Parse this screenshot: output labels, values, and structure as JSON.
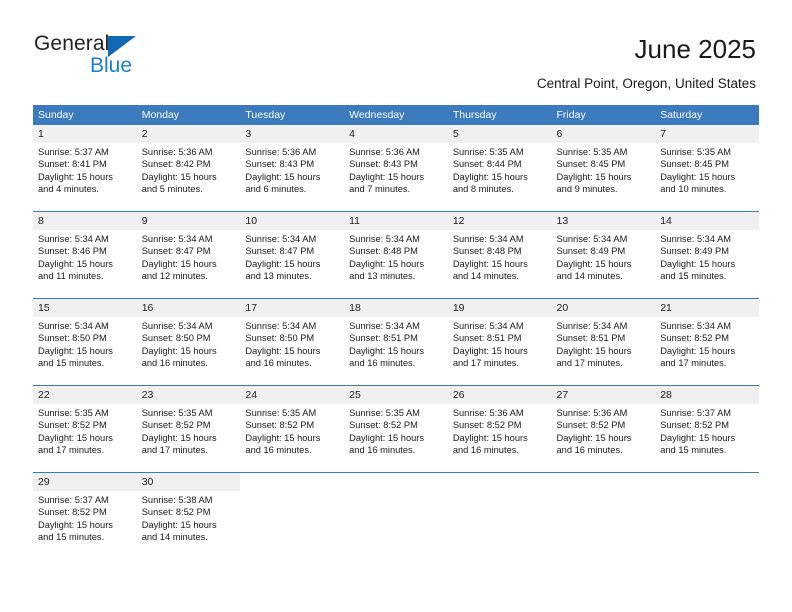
{
  "brand": {
    "name_part1": "General",
    "name_part2": "Blue",
    "triangle_color": "#1268b3",
    "blue_text_color": "#1b81d4"
  },
  "header": {
    "title": "June 2025",
    "subtitle": "Central Point, Oregon, United States",
    "header_bg_color": "#3a7abd",
    "daynum_bg_color": "#f0f0f0"
  },
  "columns": [
    "Sunday",
    "Monday",
    "Tuesday",
    "Wednesday",
    "Thursday",
    "Friday",
    "Saturday"
  ],
  "labels": {
    "sunrise_prefix": "Sunrise:",
    "sunset_prefix": "Sunset:",
    "daylight_prefix": "Daylight:"
  },
  "weeks": [
    [
      {
        "day": "1",
        "sunrise": "Sunrise: 5:37 AM",
        "sunset": "Sunset: 8:41 PM",
        "daylight_line1": "Daylight: 15 hours",
        "daylight_line2": "and 4 minutes."
      },
      {
        "day": "2",
        "sunrise": "Sunrise: 5:36 AM",
        "sunset": "Sunset: 8:42 PM",
        "daylight_line1": "Daylight: 15 hours",
        "daylight_line2": "and 5 minutes."
      },
      {
        "day": "3",
        "sunrise": "Sunrise: 5:36 AM",
        "sunset": "Sunset: 8:43 PM",
        "daylight_line1": "Daylight: 15 hours",
        "daylight_line2": "and 6 minutes."
      },
      {
        "day": "4",
        "sunrise": "Sunrise: 5:36 AM",
        "sunset": "Sunset: 8:43 PM",
        "daylight_line1": "Daylight: 15 hours",
        "daylight_line2": "and 7 minutes."
      },
      {
        "day": "5",
        "sunrise": "Sunrise: 5:35 AM",
        "sunset": "Sunset: 8:44 PM",
        "daylight_line1": "Daylight: 15 hours",
        "daylight_line2": "and 8 minutes."
      },
      {
        "day": "6",
        "sunrise": "Sunrise: 5:35 AM",
        "sunset": "Sunset: 8:45 PM",
        "daylight_line1": "Daylight: 15 hours",
        "daylight_line2": "and 9 minutes."
      },
      {
        "day": "7",
        "sunrise": "Sunrise: 5:35 AM",
        "sunset": "Sunset: 8:45 PM",
        "daylight_line1": "Daylight: 15 hours",
        "daylight_line2": "and 10 minutes."
      }
    ],
    [
      {
        "day": "8",
        "sunrise": "Sunrise: 5:34 AM",
        "sunset": "Sunset: 8:46 PM",
        "daylight_line1": "Daylight: 15 hours",
        "daylight_line2": "and 11 minutes."
      },
      {
        "day": "9",
        "sunrise": "Sunrise: 5:34 AM",
        "sunset": "Sunset: 8:47 PM",
        "daylight_line1": "Daylight: 15 hours",
        "daylight_line2": "and 12 minutes."
      },
      {
        "day": "10",
        "sunrise": "Sunrise: 5:34 AM",
        "sunset": "Sunset: 8:47 PM",
        "daylight_line1": "Daylight: 15 hours",
        "daylight_line2": "and 13 minutes."
      },
      {
        "day": "11",
        "sunrise": "Sunrise: 5:34 AM",
        "sunset": "Sunset: 8:48 PM",
        "daylight_line1": "Daylight: 15 hours",
        "daylight_line2": "and 13 minutes."
      },
      {
        "day": "12",
        "sunrise": "Sunrise: 5:34 AM",
        "sunset": "Sunset: 8:48 PM",
        "daylight_line1": "Daylight: 15 hours",
        "daylight_line2": "and 14 minutes."
      },
      {
        "day": "13",
        "sunrise": "Sunrise: 5:34 AM",
        "sunset": "Sunset: 8:49 PM",
        "daylight_line1": "Daylight: 15 hours",
        "daylight_line2": "and 14 minutes."
      },
      {
        "day": "14",
        "sunrise": "Sunrise: 5:34 AM",
        "sunset": "Sunset: 8:49 PM",
        "daylight_line1": "Daylight: 15 hours",
        "daylight_line2": "and 15 minutes."
      }
    ],
    [
      {
        "day": "15",
        "sunrise": "Sunrise: 5:34 AM",
        "sunset": "Sunset: 8:50 PM",
        "daylight_line1": "Daylight: 15 hours",
        "daylight_line2": "and 15 minutes."
      },
      {
        "day": "16",
        "sunrise": "Sunrise: 5:34 AM",
        "sunset": "Sunset: 8:50 PM",
        "daylight_line1": "Daylight: 15 hours",
        "daylight_line2": "and 16 minutes."
      },
      {
        "day": "17",
        "sunrise": "Sunrise: 5:34 AM",
        "sunset": "Sunset: 8:50 PM",
        "daylight_line1": "Daylight: 15 hours",
        "daylight_line2": "and 16 minutes."
      },
      {
        "day": "18",
        "sunrise": "Sunrise: 5:34 AM",
        "sunset": "Sunset: 8:51 PM",
        "daylight_line1": "Daylight: 15 hours",
        "daylight_line2": "and 16 minutes."
      },
      {
        "day": "19",
        "sunrise": "Sunrise: 5:34 AM",
        "sunset": "Sunset: 8:51 PM",
        "daylight_line1": "Daylight: 15 hours",
        "daylight_line2": "and 17 minutes."
      },
      {
        "day": "20",
        "sunrise": "Sunrise: 5:34 AM",
        "sunset": "Sunset: 8:51 PM",
        "daylight_line1": "Daylight: 15 hours",
        "daylight_line2": "and 17 minutes."
      },
      {
        "day": "21",
        "sunrise": "Sunrise: 5:34 AM",
        "sunset": "Sunset: 8:52 PM",
        "daylight_line1": "Daylight: 15 hours",
        "daylight_line2": "and 17 minutes."
      }
    ],
    [
      {
        "day": "22",
        "sunrise": "Sunrise: 5:35 AM",
        "sunset": "Sunset: 8:52 PM",
        "daylight_line1": "Daylight: 15 hours",
        "daylight_line2": "and 17 minutes."
      },
      {
        "day": "23",
        "sunrise": "Sunrise: 5:35 AM",
        "sunset": "Sunset: 8:52 PM",
        "daylight_line1": "Daylight: 15 hours",
        "daylight_line2": "and 17 minutes."
      },
      {
        "day": "24",
        "sunrise": "Sunrise: 5:35 AM",
        "sunset": "Sunset: 8:52 PM",
        "daylight_line1": "Daylight: 15 hours",
        "daylight_line2": "and 16 minutes."
      },
      {
        "day": "25",
        "sunrise": "Sunrise: 5:35 AM",
        "sunset": "Sunset: 8:52 PM",
        "daylight_line1": "Daylight: 15 hours",
        "daylight_line2": "and 16 minutes."
      },
      {
        "day": "26",
        "sunrise": "Sunrise: 5:36 AM",
        "sunset": "Sunset: 8:52 PM",
        "daylight_line1": "Daylight: 15 hours",
        "daylight_line2": "and 16 minutes."
      },
      {
        "day": "27",
        "sunrise": "Sunrise: 5:36 AM",
        "sunset": "Sunset: 8:52 PM",
        "daylight_line1": "Daylight: 15 hours",
        "daylight_line2": "and 16 minutes."
      },
      {
        "day": "28",
        "sunrise": "Sunrise: 5:37 AM",
        "sunset": "Sunset: 8:52 PM",
        "daylight_line1": "Daylight: 15 hours",
        "daylight_line2": "and 15 minutes."
      }
    ],
    [
      {
        "day": "29",
        "sunrise": "Sunrise: 5:37 AM",
        "sunset": "Sunset: 8:52 PM",
        "daylight_line1": "Daylight: 15 hours",
        "daylight_line2": "and 15 minutes."
      },
      {
        "day": "30",
        "sunrise": "Sunrise: 5:38 AM",
        "sunset": "Sunset: 8:52 PM",
        "daylight_line1": "Daylight: 15 hours",
        "daylight_line2": "and 14 minutes."
      },
      {
        "day": "",
        "sunrise": "",
        "sunset": "",
        "daylight_line1": "",
        "daylight_line2": ""
      },
      {
        "day": "",
        "sunrise": "",
        "sunset": "",
        "daylight_line1": "",
        "daylight_line2": ""
      },
      {
        "day": "",
        "sunrise": "",
        "sunset": "",
        "daylight_line1": "",
        "daylight_line2": ""
      },
      {
        "day": "",
        "sunrise": "",
        "sunset": "",
        "daylight_line1": "",
        "daylight_line2": ""
      },
      {
        "day": "",
        "sunrise": "",
        "sunset": "",
        "daylight_line1": "",
        "daylight_line2": ""
      }
    ]
  ]
}
